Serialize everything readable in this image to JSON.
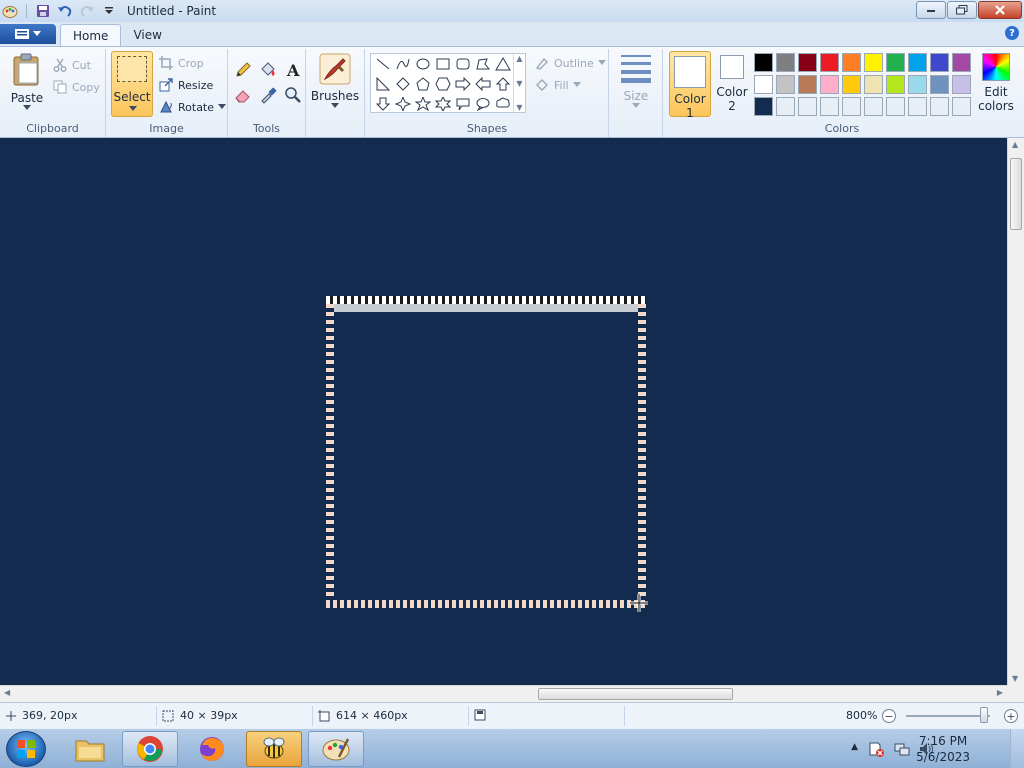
{
  "window": {
    "title": "Untitled - Paint",
    "icon": "paint-app-icon",
    "controls": [
      "minimize-icon",
      "restore-icon",
      "close-icon"
    ]
  },
  "quick_access": {
    "items": [
      "save-icon",
      "undo-icon",
      "redo-icon",
      "customize-dropdown-icon"
    ]
  },
  "tabs": {
    "home": "Home",
    "view": "View"
  },
  "ribbon": {
    "clipboard": {
      "label": "Clipboard",
      "paste": "Paste",
      "cut": "Cut",
      "copy": "Copy"
    },
    "image": {
      "label": "Image",
      "select": "Select",
      "crop": "Crop",
      "resize": "Resize",
      "rotate": "Rotate"
    },
    "tools": {
      "label": "Tools",
      "items": [
        "pencil-icon",
        "fill-bucket-icon",
        "text-icon",
        "eraser-icon",
        "color-picker-icon",
        "magnifier-icon"
      ]
    },
    "brushes": {
      "label": "Brushes"
    },
    "shapes": {
      "label": "Shapes",
      "outline": "Outline",
      "fill": "Fill"
    },
    "size": {
      "label": "Size"
    },
    "colors": {
      "label": "Colors",
      "color1": "Color",
      "color1_num": "1",
      "color2": "Color",
      "color2_num": "2",
      "edit_colors_line1": "Edit",
      "edit_colors_line2": "colors",
      "color1_value": "#ffffff",
      "color2_value": "#ffffff",
      "palette": [
        "#000000",
        "#7f7f7f",
        "#880015",
        "#ed1c24",
        "#ff7f27",
        "#fff200",
        "#22b14c",
        "#00a2e8",
        "#3f48cc",
        "#a349a4",
        "#ffffff",
        "#c3c3c3",
        "#b97a57",
        "#ffaec9",
        "#ffc90e",
        "#efe4b0",
        "#b5e61d",
        "#99d9ea",
        "#7092be",
        "#c8bfe7",
        "#122b4f",
        "#e8eef6",
        "#e8eef6",
        "#e8eef6",
        "#e8eef6",
        "#e8eef6",
        "#e8eef6",
        "#e8eef6",
        "#e8eef6",
        "#e8eef6"
      ]
    }
  },
  "canvas": {
    "background": "#122b4f"
  },
  "status": {
    "cursor_pos": "369, 20px",
    "selection_size": "40 × 39px",
    "image_size": "614 × 460px",
    "zoom": "800%",
    "zoom_fraction": 0.93
  },
  "taskbar": {
    "apps": [
      "windows-explorer-icon",
      "chrome-icon",
      "firefox-icon",
      "bee-app-icon",
      "paint-taskbar-icon"
    ],
    "time": "7:16 PM",
    "date": "5/6/2023"
  }
}
